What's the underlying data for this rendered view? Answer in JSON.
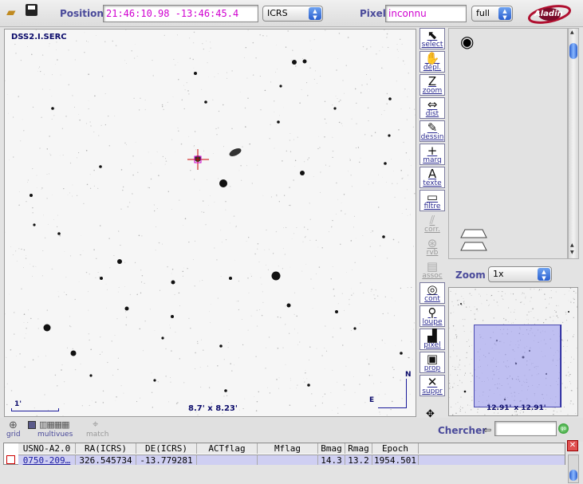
{
  "toolbar": {
    "position_label": "Position",
    "position_value": "21:46:10.98 -13:46:45.4",
    "frame_value": "ICRS",
    "pixel_label": "Pixel",
    "pixel_value": "inconnu",
    "pixel_mode_value": "full",
    "logo_text": "Aladin"
  },
  "view": {
    "survey_label": "DSS2.I.SERC",
    "size_label": "8.7' x 8.23'",
    "scale_label": "1'",
    "north_label": "N",
    "east_label": "E"
  },
  "tools": [
    {
      "label": "select",
      "icon": "cursor-icon",
      "glyph": "⬉",
      "enabled": true
    },
    {
      "label": "dépl.",
      "icon": "hand-icon",
      "glyph": "✋",
      "enabled": true
    },
    {
      "label": "zoom",
      "icon": "zoom-icon",
      "glyph": "Z",
      "enabled": true
    },
    {
      "label": "dist",
      "icon": "distance-icon",
      "glyph": "⇔",
      "enabled": true
    },
    {
      "label": "dessin",
      "icon": "pencil-icon",
      "glyph": "✎",
      "enabled": true
    },
    {
      "label": "marq",
      "icon": "crosshair-icon",
      "glyph": "+",
      "enabled": true
    },
    {
      "label": "texte",
      "icon": "text-icon",
      "glyph": "A",
      "enabled": true
    },
    {
      "label": "filtre",
      "icon": "filter-icon",
      "glyph": "▭",
      "enabled": true
    },
    {
      "label": "corr.",
      "icon": "correlation-icon",
      "glyph": "⫽",
      "enabled": false
    },
    {
      "label": "rvb",
      "icon": "rgb-icon",
      "glyph": "⊛",
      "enabled": false
    },
    {
      "label": "assoc",
      "icon": "film-icon",
      "glyph": "▤",
      "enabled": false
    },
    {
      "label": "cont",
      "icon": "contour-icon",
      "glyph": "◎",
      "enabled": true
    },
    {
      "label": "loupe",
      "icon": "magnifier-icon",
      "glyph": "⚲",
      "enabled": true
    },
    {
      "label": "pixel",
      "icon": "histogram-icon",
      "glyph": "▟",
      "enabled": true
    },
    {
      "label": "prop",
      "icon": "properties-icon",
      "glyph": "▣",
      "enabled": true
    },
    {
      "label": "suppr",
      "icon": "delete-icon",
      "glyph": "✕",
      "enabled": true
    }
  ],
  "zoom": {
    "label": "Zoom",
    "value": "1x"
  },
  "thumbnail": {
    "size_label": "12.91' x 12.91'"
  },
  "bottom": {
    "grid_label": "grid",
    "multiview_label": "multivues",
    "match_label": "match",
    "search_label": "Chercher",
    "search_value": ""
  },
  "table": {
    "headers": [
      "USNO-A2.0",
      "RA(ICRS)",
      "DE(ICRS)",
      "ACTflag",
      "Mflag",
      "Bmag",
      "Rmag",
      "Epoch"
    ],
    "rows": [
      [
        "0750-209…",
        "326.545734",
        "-13.779281",
        "",
        "",
        "14.3",
        "13.2",
        "1954.501"
      ]
    ]
  },
  "colors": {
    "accent": "#4a4a9a",
    "value_text": "#d000d0",
    "row_highlight": "#cfcff2",
    "marker": "#cc0000"
  }
}
